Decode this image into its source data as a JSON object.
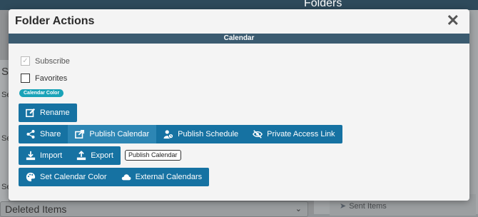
{
  "background": {
    "top_bar_title": "Folders",
    "left_letters": [
      "S",
      "Se",
      "Se",
      "Se",
      "Se"
    ],
    "select_value": "Deleted Items",
    "sent_items_label": "Sent Items"
  },
  "modal": {
    "title": "Folder Actions",
    "close_label": "✕",
    "section_title": "Calendar",
    "checkboxes": [
      {
        "label": "Subscribe",
        "checked": true,
        "disabled": true
      },
      {
        "label": "Favorites",
        "checked": false,
        "disabled": false
      }
    ],
    "calendar_color_pill": "Calendar Color",
    "buttons": {
      "rename": "Rename",
      "share": "Share",
      "publish_calendar": "Publish Calendar",
      "publish_schedule": "Publish Schedule",
      "private_access_link": "Private Access Link",
      "import": "Import",
      "export": "Export",
      "set_calendar_color": "Set Calendar Color",
      "external_calendars": "External Calendars"
    },
    "tooltip": "Publish Calendar"
  },
  "colors": {
    "button": "#1672a2",
    "button_active": "#2d86b4",
    "section_bar": "#3b5b70",
    "pill": "#1aa3b8"
  }
}
